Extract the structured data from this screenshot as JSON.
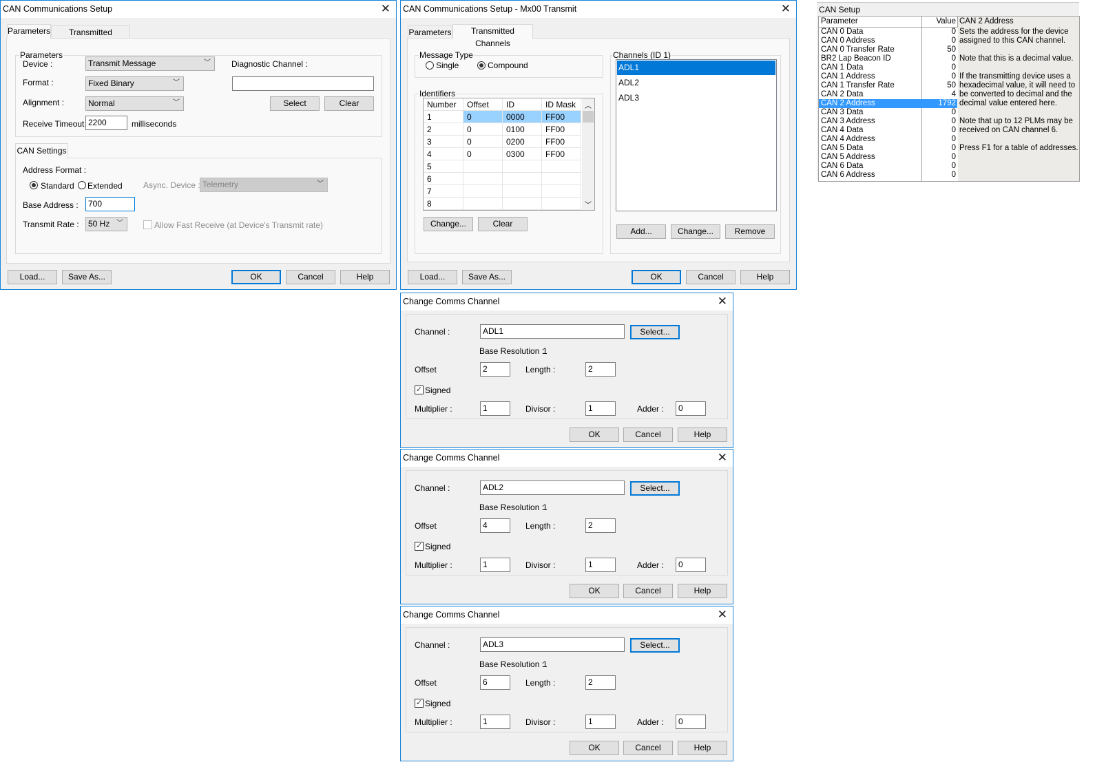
{
  "setup_params": {
    "title": "CAN Communications Setup",
    "tabs": [
      "Parameters",
      "Transmitted Channels"
    ],
    "active_tab": "Parameters",
    "params_group": "Parameters",
    "device_label": "Device :",
    "device_value": "Transmit Message",
    "format_label": "Format :",
    "format_value": "Fixed Binary",
    "alignment_label": "Alignment :",
    "alignment_value": "Normal",
    "receive_timeout_label": "Receive Timeout :",
    "receive_timeout_value": "2200",
    "receive_timeout_unit": "milliseconds",
    "diag_label": "Diagnostic Channel :",
    "diag_value": "",
    "select_label": "Select",
    "clear_label": "Clear",
    "can_settings_tab": "CAN Settings",
    "address_format_label": "Address Format :",
    "standard_label": "Standard",
    "extended_label": "Extended",
    "address_format_selected": "Standard",
    "async_label": "Async. Device :",
    "async_value": "Telemetry",
    "base_address_label": "Base Address :",
    "base_address_value": "700",
    "transmit_rate_label": "Transmit Rate :",
    "transmit_rate_value": "50 Hz",
    "fast_receive_label": "Allow Fast Receive (at Device's Transmit rate)",
    "fast_receive_checked": false,
    "buttons": {
      "load": "Load...",
      "save_as": "Save As...",
      "ok": "OK",
      "cancel": "Cancel",
      "help": "Help"
    }
  },
  "setup_channels": {
    "title": "CAN Communications Setup - Mx00 Transmit",
    "tabs": [
      "Parameters",
      "Transmitted Channels"
    ],
    "active_tab": "Transmitted Channels",
    "message_type_group": "Message Type",
    "single_label": "Single",
    "compound_label": "Compound",
    "message_type_selected": "Compound",
    "identifiers_group": "Identifiers",
    "columns": [
      "Number",
      "Offset",
      "ID",
      "ID Mask"
    ],
    "rows": [
      [
        "1",
        "0",
        "0000",
        "FF00"
      ],
      [
        "2",
        "0",
        "0100",
        "FF00"
      ],
      [
        "3",
        "0",
        "0200",
        "FF00"
      ],
      [
        "4",
        "0",
        "0300",
        "FF00"
      ],
      [
        "5",
        "",
        "",
        ""
      ],
      [
        "6",
        "",
        "",
        ""
      ],
      [
        "7",
        "",
        "",
        ""
      ],
      [
        "8",
        "",
        "",
        ""
      ]
    ],
    "selected_row": 0,
    "change_label": "Change...",
    "clear_label": "Clear",
    "channels_group": "Channels (ID 1)",
    "channels": [
      "ADL1",
      "ADL2",
      "ADL3"
    ],
    "selected_channel": "ADL1",
    "add_label": "Add...",
    "change2_label": "Change...",
    "remove_label": "Remove",
    "buttons": {
      "load": "Load...",
      "save_as": "Save As...",
      "ok": "OK",
      "cancel": "Cancel",
      "help": "Help"
    }
  },
  "change_dialogs": [
    {
      "title": "Change Comms Channel",
      "channel_label": "Channel :",
      "channel": "ADL1",
      "select": "Select...",
      "base_res_label": "Base Resolution :",
      "base_res": "1",
      "offset_label": "Offset",
      "offset": "2",
      "length_label": "Length :",
      "length": "2",
      "signed_label": "Signed",
      "signed": true,
      "multiplier_label": "Multiplier :",
      "multiplier": "1",
      "divisor_label": "Divisor :",
      "divisor": "1",
      "adder_label": "Adder :",
      "adder": "0",
      "ok": "OK",
      "cancel": "Cancel",
      "help": "Help"
    },
    {
      "title": "Change Comms Channel",
      "channel_label": "Channel :",
      "channel": "ADL2",
      "select": "Select...",
      "base_res_label": "Base Resolution :",
      "base_res": "1",
      "offset_label": "Offset",
      "offset": "4",
      "length_label": "Length :",
      "length": "2",
      "signed_label": "Signed",
      "signed": true,
      "multiplier_label": "Multiplier :",
      "multiplier": "1",
      "divisor_label": "Divisor :",
      "divisor": "1",
      "adder_label": "Adder :",
      "adder": "0",
      "ok": "OK",
      "cancel": "Cancel",
      "help": "Help"
    },
    {
      "title": "Change Comms Channel",
      "channel_label": "Channel :",
      "channel": "ADL3",
      "select": "Select...",
      "base_res_label": "Base Resolution :",
      "base_res": "1",
      "offset_label": "Offset",
      "offset": "6",
      "length_label": "Length :",
      "length": "2",
      "signed_label": "Signed",
      "signed": true,
      "multiplier_label": "Multiplier :",
      "multiplier": "1",
      "divisor_label": "Divisor :",
      "divisor": "1",
      "adder_label": "Adder :",
      "adder": "0",
      "ok": "OK",
      "cancel": "Cancel",
      "help": "Help"
    }
  ],
  "can_setup": {
    "title": "CAN Setup",
    "col_parameter": "Parameter",
    "col_value": "Value",
    "desc_title": "CAN 2 Address",
    "rows": [
      [
        "CAN 0 Data",
        "0"
      ],
      [
        "CAN 0 Address",
        "0"
      ],
      [
        "CAN 0 Transfer Rate",
        "50"
      ],
      [
        "BR2 Lap Beacon ID",
        "0"
      ],
      [
        "CAN 1 Data",
        "0"
      ],
      [
        "CAN 1 Address",
        "0"
      ],
      [
        "CAN 1 Transfer Rate",
        "50"
      ],
      [
        "CAN 2 Data",
        "4"
      ],
      [
        "CAN 2 Address",
        "1792"
      ],
      [
        "CAN 3 Data",
        "0"
      ],
      [
        "CAN 3 Address",
        "0"
      ],
      [
        "CAN 4 Data",
        "0"
      ],
      [
        "CAN 4 Address",
        "0"
      ],
      [
        "CAN 5 Data",
        "0"
      ],
      [
        "CAN 5 Address",
        "0"
      ],
      [
        "CAN 6 Data",
        "0"
      ],
      [
        "CAN 6 Address",
        "0"
      ]
    ],
    "selected_row": 8,
    "description": "Sets the address for the device\nassigned to this CAN channel.\n\nNote that this is a decimal value.\n\nIf the transmitting device uses a\nhexadecimal value, it will need to\nbe converted to decimal and the\ndecimal value entered here.\n\nNote that up to 12 PLMs may be\nreceived on CAN channel 6.\n\nPress F1 for a table of addresses.",
    "highlight_color": "#3399ff"
  },
  "colors": {
    "accent": "#0078d7",
    "selection": "#99d1ff"
  }
}
